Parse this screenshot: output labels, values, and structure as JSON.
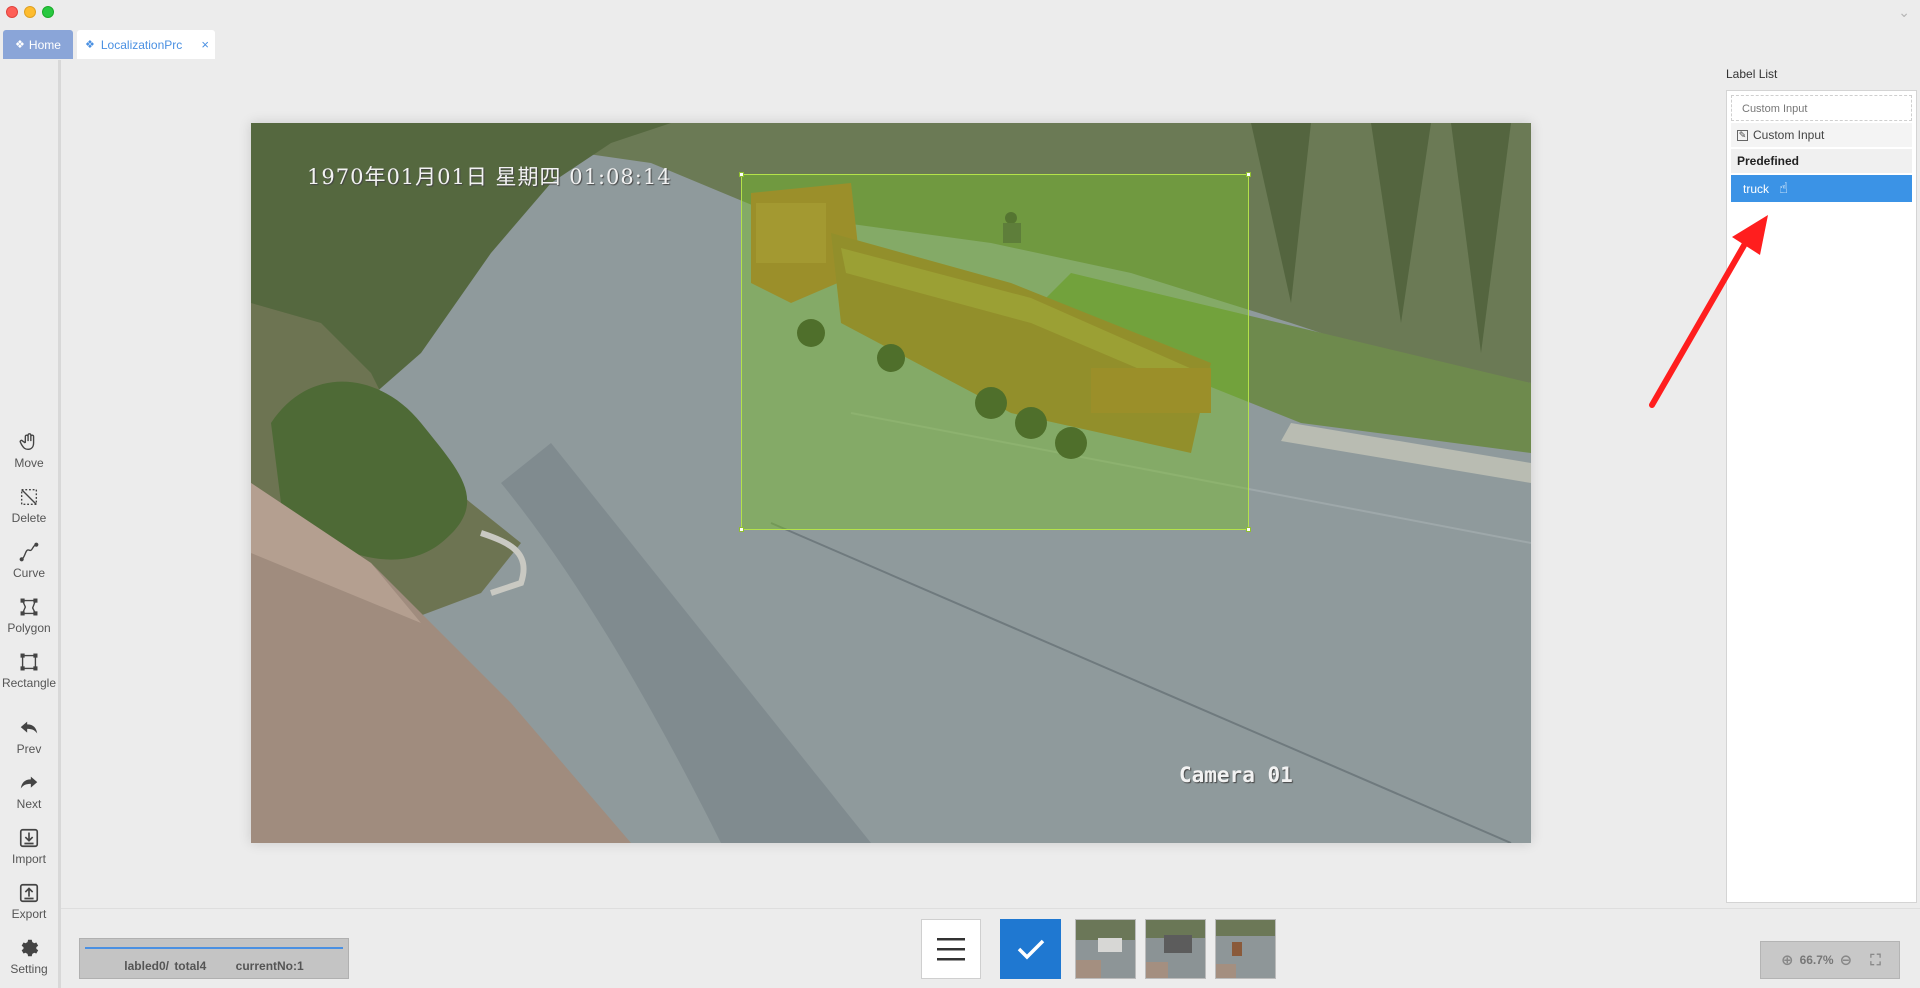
{
  "window": {
    "tabs": [
      {
        "label": "Home",
        "icon": "home-icon"
      },
      {
        "label": "LocalizationPrc",
        "icon": "app-icon",
        "close": "×"
      }
    ]
  },
  "toolbar": {
    "tools": [
      {
        "id": "move",
        "label": "Move",
        "icon": "hand-icon"
      },
      {
        "id": "delete",
        "label": "Delete",
        "icon": "delete-selection-icon"
      },
      {
        "id": "curve",
        "label": "Curve",
        "icon": "curve-icon"
      },
      {
        "id": "polygon",
        "label": "Polygon",
        "icon": "polygon-icon"
      },
      {
        "id": "rectangle",
        "label": "Rectangle",
        "icon": "rectangle-icon"
      },
      {
        "id": "prev",
        "label": "Prev",
        "icon": "prev-arrow-icon"
      },
      {
        "id": "next",
        "label": "Next",
        "icon": "next-arrow-icon"
      },
      {
        "id": "import",
        "label": "Import",
        "icon": "import-icon"
      },
      {
        "id": "export",
        "label": "Export",
        "icon": "export-icon"
      },
      {
        "id": "setting",
        "label": "Setting",
        "icon": "gear-icon"
      }
    ]
  },
  "image": {
    "timestamp": "1970年01月01日  星期四  01:08:14",
    "camera": "Camera 01"
  },
  "label_panel": {
    "title": "Label List",
    "custom_input_placeholder": "Custom Input",
    "custom_item": "Custom Input",
    "predefined_header": "Predefined",
    "labels": [
      {
        "name": "truck",
        "selected": true
      }
    ]
  },
  "status": {
    "labeled": "labled0/ total4",
    "current": "currentNo:1"
  },
  "zoom": {
    "value": "66.7%"
  },
  "colors": {
    "accent": "#3b93e6",
    "confirm": "#1f78d1",
    "bbox": "#8fd13f",
    "annotation_arrow": "#ff1e1e"
  }
}
